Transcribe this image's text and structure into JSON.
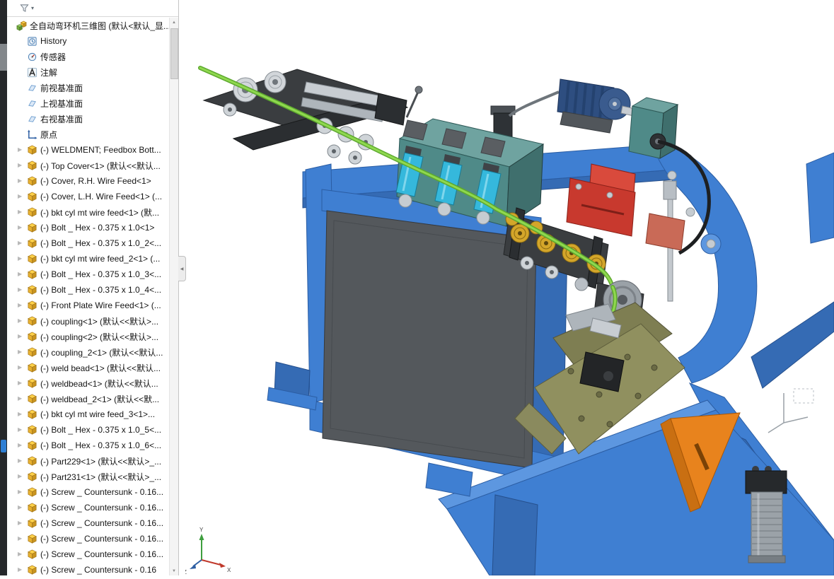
{
  "colors": {
    "frame-blue": "#3f7fd2",
    "frame-blue-dark": "#356bb4",
    "frame-blue-light": "#5d97e0",
    "panel-gray": "#54585c",
    "wire-green": "#8fd84f",
    "brass": "#d4a62a",
    "teal": "#4f8a88",
    "teal-light": "#6fa3a0",
    "teal-dark": "#3f6f6d",
    "motor-navy": "#2e4e80",
    "accent-red": "#c8392e",
    "accent-orange": "#e8831d",
    "steel": "#c8cdd2",
    "dark-steel": "#3a3d40",
    "olive": "#90905f",
    "olive-dark": "#7e7e52"
  },
  "icons": {
    "expand": "▶",
    "scroll_up": "▲",
    "scroll_down": "▼",
    "caret": "▾",
    "collapse": "◀"
  },
  "tree": {
    "items": [
      {
        "label": "全自动弯环机三维图 (默认<默认_显...",
        "icon": "assembly",
        "arrow": false,
        "root": true
      },
      {
        "label": "History",
        "icon": "history",
        "arrow": false
      },
      {
        "label": "传感器",
        "icon": "sensor",
        "arrow": false
      },
      {
        "label": "注解",
        "icon": "annotation",
        "arrow": false
      },
      {
        "label": "前视基准面",
        "icon": "plane",
        "arrow": false
      },
      {
        "label": "上视基准面",
        "icon": "plane",
        "arrow": false
      },
      {
        "label": "右视基准面",
        "icon": "plane",
        "arrow": false
      },
      {
        "label": "原点",
        "icon": "origin",
        "arrow": false
      },
      {
        "label": "(-) WELDMENT; Feedbox Bott...",
        "icon": "part",
        "arrow": true
      },
      {
        "label": "(-) Top Cover<1> (默认<<默认...",
        "icon": "part",
        "arrow": true
      },
      {
        "label": "(-) Cover, R.H. Wire Feed<1>",
        "icon": "part",
        "arrow": true
      },
      {
        "label": "(-) Cover, L.H. Wire Feed<1> (...",
        "icon": "part",
        "arrow": true
      },
      {
        "label": "(-) bkt cyl mt wire feed<1> (默...",
        "icon": "part",
        "arrow": true
      },
      {
        "label": "(-) Bolt _ Hex - 0.375 x 1.0<1>",
        "icon": "part",
        "arrow": true
      },
      {
        "label": "(-) Bolt _ Hex - 0.375 x 1.0_2<...",
        "icon": "part",
        "arrow": true
      },
      {
        "label": "(-) bkt cyl mt wire feed_2<1> (...",
        "icon": "part",
        "arrow": true
      },
      {
        "label": "(-) Bolt _ Hex - 0.375 x 1.0_3<...",
        "icon": "part",
        "arrow": true
      },
      {
        "label": "(-) Bolt _ Hex - 0.375 x 1.0_4<...",
        "icon": "part",
        "arrow": true
      },
      {
        "label": "(-) Front Plate Wire Feed<1> (...",
        "icon": "part",
        "arrow": true
      },
      {
        "label": "(-) coupling<1> (默认<<默认>...",
        "icon": "part",
        "arrow": true
      },
      {
        "label": "(-) coupling<2> (默认<<默认>...",
        "icon": "part",
        "arrow": true
      },
      {
        "label": "(-) coupling_2<1> (默认<<默认...",
        "icon": "part",
        "arrow": true
      },
      {
        "label": "(-) weld bead<1> (默认<<默认...",
        "icon": "part",
        "arrow": true
      },
      {
        "label": "(-) weldbead<1> (默认<<默认...",
        "icon": "part",
        "arrow": true
      },
      {
        "label": "(-) weldbead_2<1> (默认<<默...",
        "icon": "part",
        "arrow": true
      },
      {
        "label": "(-) bkt cyl mt wire feed_3<1>...",
        "icon": "part",
        "arrow": true
      },
      {
        "label": "(-) Bolt _ Hex - 0.375 x 1.0_5<...",
        "icon": "part",
        "arrow": true
      },
      {
        "label": "(-) Bolt _ Hex - 0.375 x 1.0_6<...",
        "icon": "part",
        "arrow": true
      },
      {
        "label": "(-) Part229<1> (默认<<默认>_...",
        "icon": "part",
        "arrow": true
      },
      {
        "label": "(-) Part231<1> (默认<<默认>_...",
        "icon": "part",
        "arrow": true
      },
      {
        "label": "(-) Screw _ Countersunk - 0.16...",
        "icon": "part",
        "arrow": true
      },
      {
        "label": "(-) Screw _ Countersunk - 0.16...",
        "icon": "part",
        "arrow": true
      },
      {
        "label": "(-) Screw _ Countersunk - 0.16...",
        "icon": "part",
        "arrow": true
      },
      {
        "label": "(-) Screw _ Countersunk - 0.16...",
        "icon": "part",
        "arrow": true
      },
      {
        "label": "(-) Screw _ Countersunk - 0.16...",
        "icon": "part",
        "arrow": true
      },
      {
        "label": "(-) Screw _ Countersunk - 0.16",
        "icon": "part",
        "arrow": true
      }
    ]
  },
  "viewport": {
    "triad": {
      "x": "X",
      "y": "Y",
      "z": "Z"
    }
  }
}
